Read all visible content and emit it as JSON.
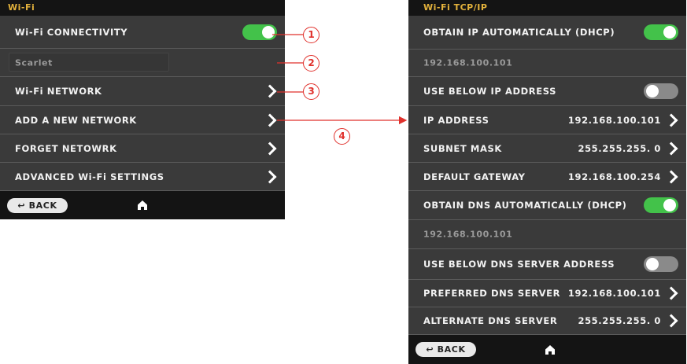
{
  "wifi_screen": {
    "title": "Wi-Fi",
    "connectivity_label": "Wi-Fi CONNECTIVITY",
    "connectivity_on": true,
    "ssid": "Scarlet",
    "network_label": "Wi-Fi NETWORK",
    "add_network_label": "ADD A NEW NETWORK",
    "forget_network_label": "FORGET NETOWRK",
    "advanced_label": "ADVANCED Wi-Fi SETTINGS",
    "back_label": "BACK",
    "home_icon": "home-icon"
  },
  "tcpip_screen": {
    "title": "Wi-Fi TCP/IP",
    "dhcp_ip_label": "OBTAIN IP AUTOMATICALLY (DHCP)",
    "dhcp_ip_on": true,
    "auto_ip": "192.168.100.101",
    "use_below_ip_label": "USE BELOW IP ADDRESS",
    "use_below_ip_on": false,
    "ip_address_label": "IP ADDRESS",
    "ip_address_value": "192.168.100.101",
    "subnet_label": "SUBNET MASK",
    "subnet_value": "255.255.255. 0",
    "gateway_label": "DEFAULT GATEWAY",
    "gateway_value": "192.168.100.254",
    "dhcp_dns_label": "OBTAIN DNS AUTOMATICALLY (DHCP)",
    "dhcp_dns_on": true,
    "auto_dns": "192.168.100.101",
    "use_below_dns_label": "USE BELOW DNS SERVER ADDRESS",
    "use_below_dns_on": false,
    "preferred_dns_label": "PREFERRED DNS SERVER",
    "preferred_dns_value": "192.168.100.101",
    "alternate_dns_label": "ALTERNATE DNS SERVER",
    "alternate_dns_value": "255.255.255. 0",
    "back_label": "BACK",
    "home_icon": "home-icon"
  },
  "callouts": [
    "1",
    "2",
    "3",
    "4"
  ],
  "colors": {
    "accent_title": "#e3b23c",
    "toggle_on": "#43c24a",
    "toggle_off": "#8a8a8a",
    "callout_red": "#e0312c",
    "screen_bg": "#3a3a3a",
    "bar_bg": "#141414"
  }
}
